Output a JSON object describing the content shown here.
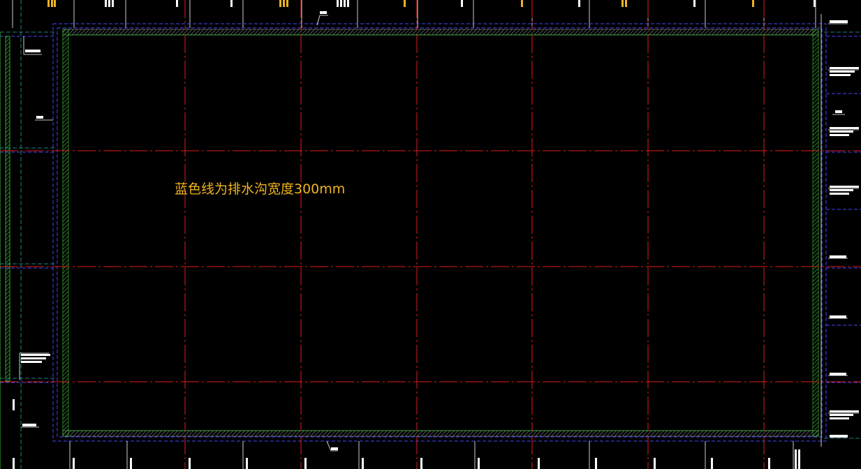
{
  "annotation": {
    "text": "蓝色线为排水沟宽度300mm",
    "color": "#f0b41e"
  },
  "colors": {
    "background": "#000000",
    "axis_red": "#e01c1c",
    "drain_blue": "#4646ff",
    "wall_green": "#3cc83c",
    "wall_hatch": "#8c8c8c",
    "dim_white": "#ffffff",
    "label_yellow": "#f0b41e",
    "cyan_line": "#2aa6a6"
  }
}
